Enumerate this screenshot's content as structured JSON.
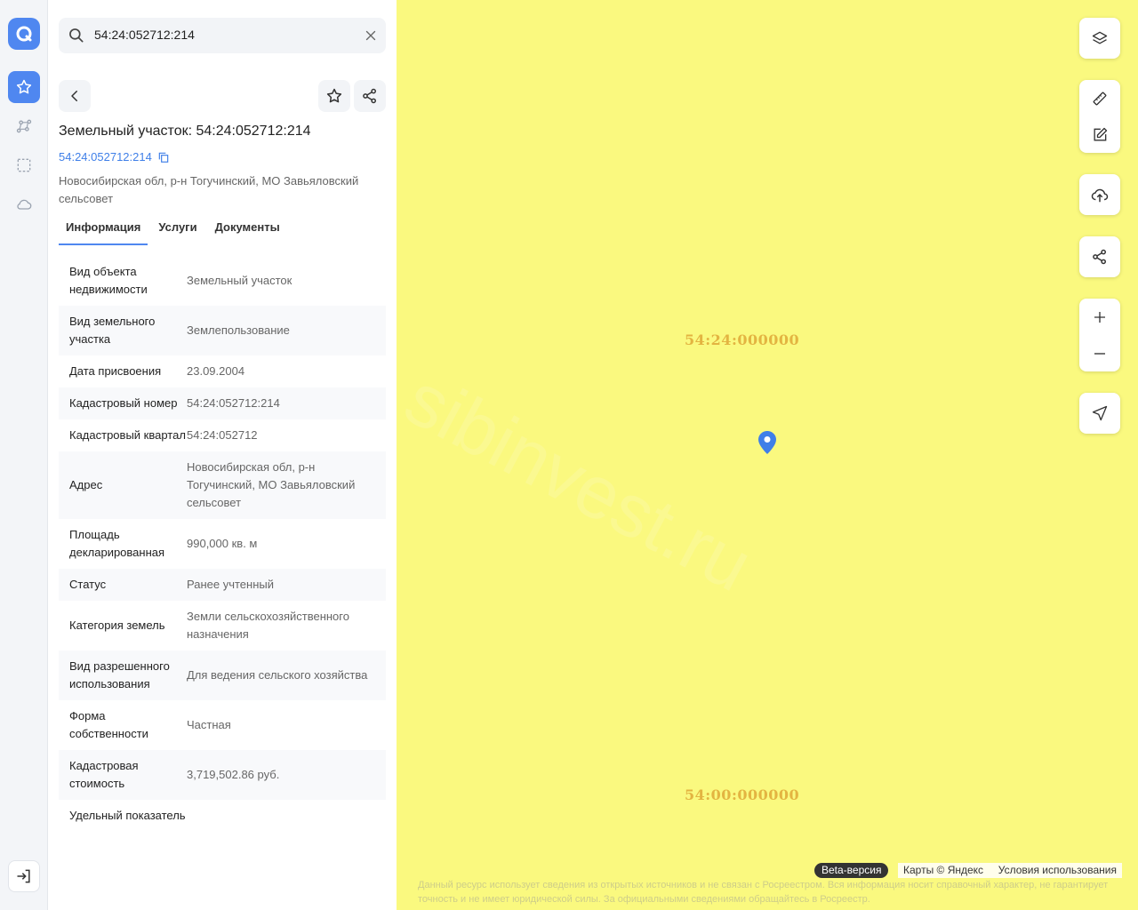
{
  "search": {
    "value": "54:24:052712:214"
  },
  "object": {
    "title": "Земельный участок: 54:24:052712:214",
    "cadastral_link": "54:24:052712:214",
    "address": "Новосибирская обл, р-н Тогучинский, МО Завьяловский сельсовет"
  },
  "tabs": [
    "Информация",
    "Услуги",
    "Документы"
  ],
  "info_rows": [
    {
      "key": "Вид объекта недвижимости",
      "value": "Земельный участок"
    },
    {
      "key": "Вид земельного участка",
      "value": "Землепользование"
    },
    {
      "key": "Дата присвоения",
      "value": "23.09.2004"
    },
    {
      "key": "Кадастровый номер",
      "value": "54:24:052712:214"
    },
    {
      "key": "Кадастровый квартал",
      "value": "54:24:052712"
    },
    {
      "key": "Адрес",
      "value": "Новосибирская обл, р-н Тогучинский, МО Завьяловский сельсовет"
    },
    {
      "key": "Площадь декларированная",
      "value": "990,000 кв. м"
    },
    {
      "key": "Статус",
      "value": "Ранее учтенный"
    },
    {
      "key": "Категория земель",
      "value": "Земли сельскохозяйственного назначения"
    },
    {
      "key": "Вид разрешенного использования",
      "value": "Для ведения сельского хозяйства"
    },
    {
      "key": "Форма собственности",
      "value": "Частная"
    },
    {
      "key": "Кадастровая стоимость",
      "value": "3,719,502.86 руб."
    },
    {
      "key": "Удельный показатель",
      "value": ""
    }
  ],
  "map": {
    "label_top": "54:24:000000",
    "label_bottom": "54:00:000000",
    "watermark": "sibinvest.ru",
    "beta": "Beta-версия",
    "yandex": "Карты © Яндекс",
    "terms": "Условия использования",
    "disclaimer": "Данный ресурс использует сведения из открытых источников и не связан с Росреестром. Вся информация носит справочный характер, не гарантирует точность и не имеет юридической силы. За официальными сведениями обращайтесь в Росреестр."
  },
  "colors": {
    "accent": "#4f87f0",
    "map_bg": "#faf97f",
    "label": "#e3b441"
  },
  "icons": [
    "logo-icon",
    "star-icon",
    "route-icon",
    "select-area-icon",
    "cloud-icon",
    "logout-icon",
    "search-icon",
    "clear-icon",
    "back-icon",
    "share-icon",
    "copy-icon",
    "layers-icon",
    "ruler-icon",
    "edit-icon",
    "upload-icon",
    "plus-icon",
    "minus-icon",
    "locate-icon",
    "map-pin-icon",
    "chevron-left-icon"
  ]
}
